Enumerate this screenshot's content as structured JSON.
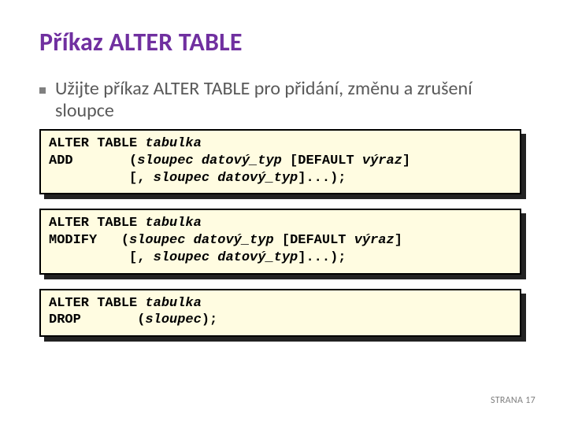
{
  "title": "Příkaz ALTER TABLE",
  "bullet": "Užijte příkaz ALTER TABLE pro přidání, změnu a zrušení sloupce",
  "code": {
    "box1_line1_a": "ALTER TABLE ",
    "box1_line1_b": "tabulka",
    "box1_line2_a": "ADD       (",
    "box1_line2_b": "sloupec datový_typ",
    "box1_line2_c": " [DEFAULT ",
    "box1_line2_d": "výraz",
    "box1_line2_e": "]",
    "box1_line3_a": "          [, ",
    "box1_line3_b": "sloupec datový_typ",
    "box1_line3_c": "]...);",
    "box2_line1_a": "ALTER TABLE ",
    "box2_line1_b": "tabulka",
    "box2_line2_a": "MODIFY   (",
    "box2_line2_b": "sloupec datový_typ",
    "box2_line2_c": " [DEFAULT ",
    "box2_line2_d": "výraz",
    "box2_line2_e": "]",
    "box2_line3_a": "          [, ",
    "box2_line3_b": "sloupec datový_typ",
    "box2_line3_c": "]...);",
    "box3_line1_a": "ALTER TABLE ",
    "box3_line1_b": "tabulka",
    "box3_line2_a": "DROP       (",
    "box3_line2_b": "sloupec",
    "box3_line2_c": ");"
  },
  "footer_label": "STRANA ",
  "footer_page": "17"
}
